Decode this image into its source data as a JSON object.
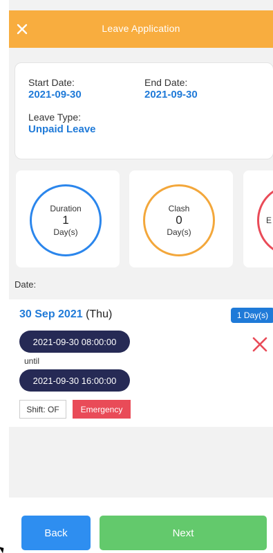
{
  "header": {
    "title": "Leave Application",
    "close_icon": "close-icon"
  },
  "summary": {
    "start_label": "Start Date:",
    "start_value": "2021-09-30",
    "end_label": "End Date:",
    "end_value": "2021-09-30",
    "type_label": "Leave Type:",
    "type_value": "Unpaid Leave"
  },
  "stats": [
    {
      "label": "Duration",
      "value": "1",
      "unit": "Day(s)",
      "color": "#2b86ec"
    },
    {
      "label": "Clash",
      "value": "0",
      "unit": "Day(s)",
      "color": "#f3a73b"
    },
    {
      "label": "E",
      "color": "#e94b58"
    }
  ],
  "date_section_label": "Date:",
  "entry": {
    "date_main": "30 Sep 2021",
    "date_day": " (Thu)",
    "days_badge": "1 Day(s)",
    "start_time": "2021-09-30 08:00:00",
    "until_label": "until",
    "end_time": "2021-09-30 16:00:00",
    "shift": "Shift: OF",
    "tag": "Emergency",
    "remove_icon": "remove-icon"
  },
  "buttons": {
    "back": "Back",
    "next": "Next"
  },
  "colors": {
    "header": "#f8ad3f",
    "accent_blue": "#1f7ad8",
    "pill": "#262a55",
    "emergency": "#e94b58",
    "next": "#63c96c",
    "back": "#2e8ef0"
  }
}
